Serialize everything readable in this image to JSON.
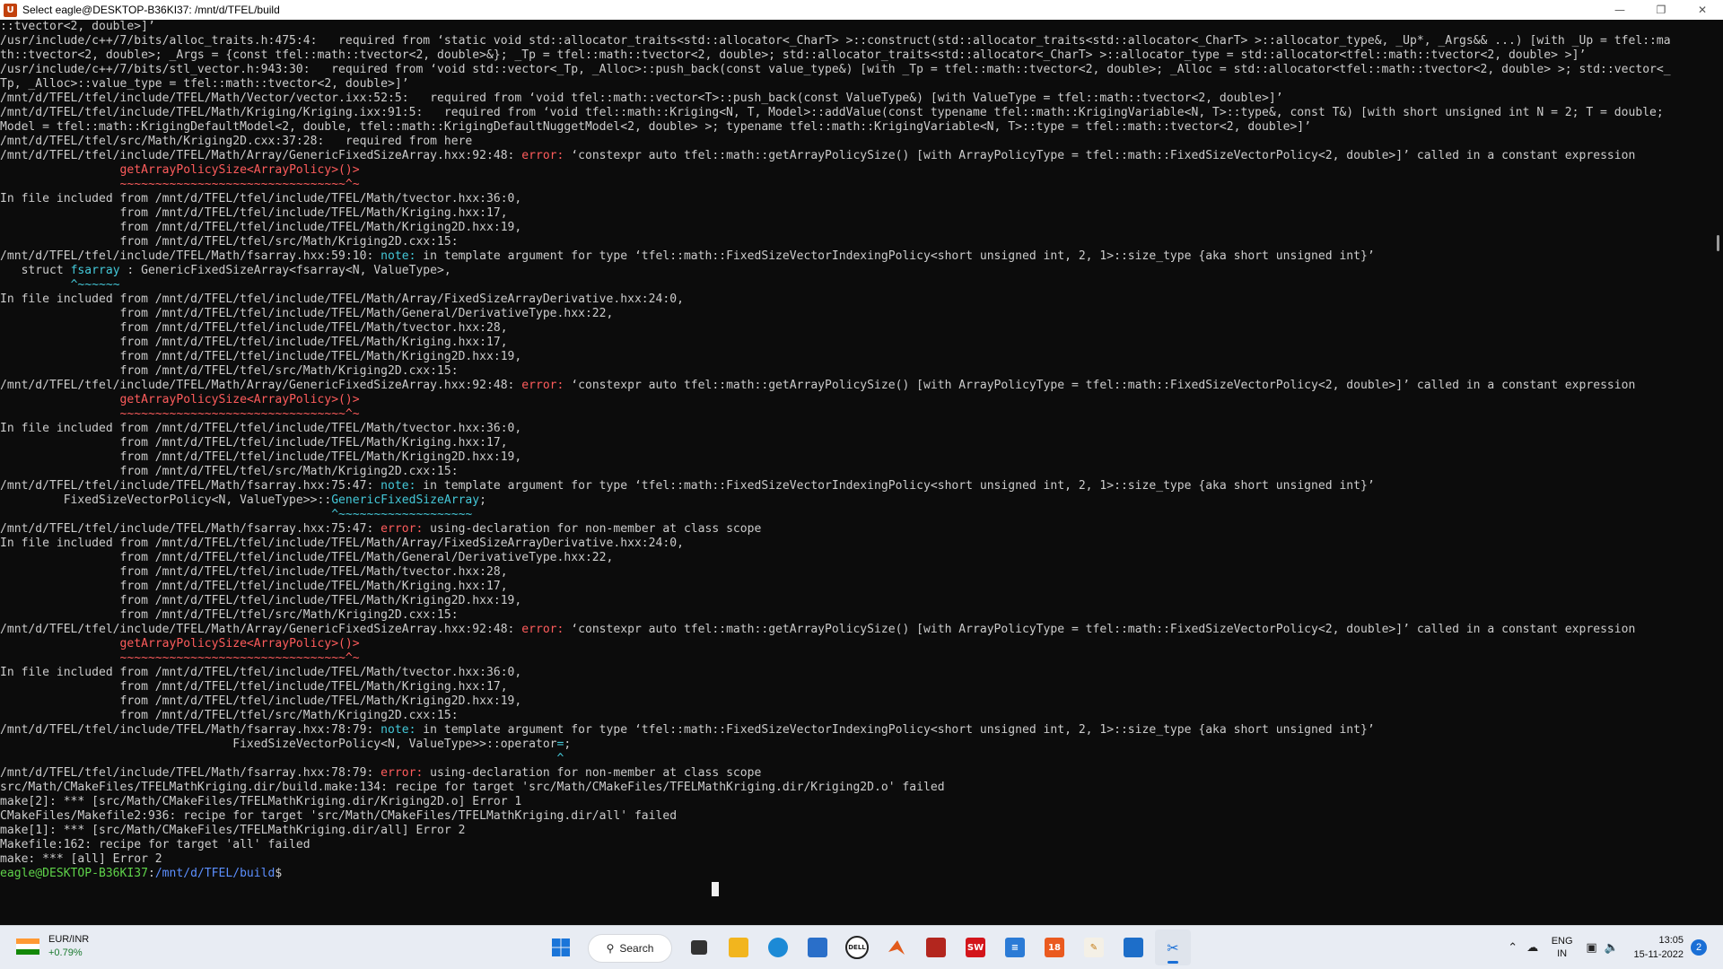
{
  "window": {
    "title": "Select eagle@DESKTOP-B36KI37: /mnt/d/TFEL/build",
    "icon": "ubuntu-terminal-icon",
    "controls": [
      "minimize",
      "restore",
      "close"
    ]
  },
  "terminal": {
    "lines": [
      [
        {
          "t": "::tvector<2, double>]’"
        }
      ],
      [
        {
          "t": "/usr/include/c++/7/bits/alloc_traits.h:475:4:   required from ‘static void std::allocator_traits<std::allocator<_CharT> >::construct(std::allocator_traits<std::allocator<_CharT> >::allocator_type&, _Up*, _Args&& ...) [with _Up = tfel::ma"
        }
      ],
      [
        {
          "t": "th::tvector<2, double>; _Args = {const tfel::math::tvector<2, double>&}; _Tp = tfel::math::tvector<2, double>; std::allocator_traits<std::allocator<_CharT> >::allocator_type = std::allocator<tfel::math::tvector<2, double> >]’"
        }
      ],
      [
        {
          "t": "/usr/include/c++/7/bits/stl_vector.h:943:30:   required from ‘void std::vector<_Tp, _Alloc>::push_back(const value_type&) [with _Tp = tfel::math::tvector<2, double>; _Alloc = std::allocator<tfel::math::tvector<2, double> >; std::vector<_"
        }
      ],
      [
        {
          "t": "Tp, _Alloc>::value_type = tfel::math::tvector<2, double>]’"
        }
      ],
      [
        {
          "t": "/mnt/d/TFEL/tfel/include/TFEL/Math/Vector/vector.ixx:52:5:   required from ‘void tfel::math::vector<T>::push_back(const ValueType&) [with ValueType = tfel::math::tvector<2, double>]’"
        }
      ],
      [
        {
          "t": "/mnt/d/TFEL/tfel/include/TFEL/Math/Kriging/Kriging.ixx:91:5:   required from ‘void tfel::math::Kriging<N, T, Model>::addValue(const typename tfel::math::KrigingVariable<N, T>::type&, const T&) [with short unsigned int N = 2; T = double;"
        }
      ],
      [
        {
          "t": "Model = tfel::math::KrigingDefaultModel<2, double, tfel::math::KrigingDefaultNuggetModel<2, double> >; typename tfel::math::KrigingVariable<N, T>::type = tfel::math::tvector<2, double>]’"
        }
      ],
      [
        {
          "t": "/mnt/d/TFEL/tfel/src/Math/Kriging2D.cxx:37:28:   required from here"
        }
      ],
      [
        {
          "t": "/mnt/d/TFEL/tfel/include/TFEL/Math/Array/GenericFixedSizeArray.hxx:92:48: "
        },
        {
          "t": "error:",
          "c": "err"
        },
        {
          "t": " ‘constexpr auto tfel::math::getArrayPolicySize() [with ArrayPolicyType = tfel::math::FixedSizeVectorPolicy<2, double>]’ called in a constant expression"
        }
      ],
      [
        {
          "t": "                 "
        },
        {
          "t": "getArrayPolicySize<ArrayPolicy>()>",
          "c": "red"
        }
      ],
      [
        {
          "t": "                 "
        },
        {
          "t": "~~~~~~~~~~~~~~~~~~~~~~~~~~~~~~~~^~",
          "c": "red"
        }
      ],
      [
        {
          "t": "In file included from /mnt/d/TFEL/tfel/include/TFEL/Math/tvector.hxx:36:0,"
        }
      ],
      [
        {
          "t": "                 from /mnt/d/TFEL/tfel/include/TFEL/Math/Kriging.hxx:17,"
        }
      ],
      [
        {
          "t": "                 from /mnt/d/TFEL/tfel/include/TFEL/Math/Kriging2D.hxx:19,"
        }
      ],
      [
        {
          "t": "                 from /mnt/d/TFEL/tfel/src/Math/Kriging2D.cxx:15:"
        }
      ],
      [
        {
          "t": "/mnt/d/TFEL/tfel/include/TFEL/Math/fsarray.hxx:59:10: "
        },
        {
          "t": "note:",
          "c": "note"
        },
        {
          "t": " in template argument for type ‘tfel::math::FixedSizeVectorIndexingPolicy<short unsigned int, 2, 1>::size_type {aka short unsigned int}’"
        }
      ],
      [
        {
          "t": "   struct "
        },
        {
          "t": "fsarray",
          "c": "cyan"
        },
        {
          "t": " : GenericFixedSizeArray<fsarray<N, ValueType>,"
        }
      ],
      [
        {
          "t": "          "
        },
        {
          "t": "^~~~~~~",
          "c": "cyan"
        }
      ],
      [
        {
          "t": "In file included from /mnt/d/TFEL/tfel/include/TFEL/Math/Array/FixedSizeArrayDerivative.hxx:24:0,"
        }
      ],
      [
        {
          "t": "                 from /mnt/d/TFEL/tfel/include/TFEL/Math/General/DerivativeType.hxx:22,"
        }
      ],
      [
        {
          "t": "                 from /mnt/d/TFEL/tfel/include/TFEL/Math/tvector.hxx:28,"
        }
      ],
      [
        {
          "t": "                 from /mnt/d/TFEL/tfel/include/TFEL/Math/Kriging.hxx:17,"
        }
      ],
      [
        {
          "t": "                 from /mnt/d/TFEL/tfel/include/TFEL/Math/Kriging2D.hxx:19,"
        }
      ],
      [
        {
          "t": "                 from /mnt/d/TFEL/tfel/src/Math/Kriging2D.cxx:15:"
        }
      ],
      [
        {
          "t": "/mnt/d/TFEL/tfel/include/TFEL/Math/Array/GenericFixedSizeArray.hxx:92:48: "
        },
        {
          "t": "error:",
          "c": "err"
        },
        {
          "t": " ‘constexpr auto tfel::math::getArrayPolicySize() [with ArrayPolicyType = tfel::math::FixedSizeVectorPolicy<2, double>]’ called in a constant expression"
        }
      ],
      [
        {
          "t": "                 "
        },
        {
          "t": "getArrayPolicySize<ArrayPolicy>()>",
          "c": "red"
        }
      ],
      [
        {
          "t": "                 "
        },
        {
          "t": "~~~~~~~~~~~~~~~~~~~~~~~~~~~~~~~~^~",
          "c": "red"
        }
      ],
      [
        {
          "t": "In file included from /mnt/d/TFEL/tfel/include/TFEL/Math/tvector.hxx:36:0,"
        }
      ],
      [
        {
          "t": "                 from /mnt/d/TFEL/tfel/include/TFEL/Math/Kriging.hxx:17,"
        }
      ],
      [
        {
          "t": "                 from /mnt/d/TFEL/tfel/include/TFEL/Math/Kriging2D.hxx:19,"
        }
      ],
      [
        {
          "t": "                 from /mnt/d/TFEL/tfel/src/Math/Kriging2D.cxx:15:"
        }
      ],
      [
        {
          "t": "/mnt/d/TFEL/tfel/include/TFEL/Math/fsarray.hxx:75:47: "
        },
        {
          "t": "note:",
          "c": "note"
        },
        {
          "t": " in template argument for type ‘tfel::math::FixedSizeVectorIndexingPolicy<short unsigned int, 2, 1>::size_type {aka short unsigned int}’"
        }
      ],
      [
        {
          "t": "         FixedSizeVectorPolicy<N, ValueType>>::"
        },
        {
          "t": "GenericFixedSizeArray",
          "c": "cyan"
        },
        {
          "t": ";"
        }
      ],
      [
        {
          "t": "                                               "
        },
        {
          "t": "^~~~~~~~~~~~~~~~~~~~",
          "c": "cyan"
        }
      ],
      [
        {
          "t": "/mnt/d/TFEL/tfel/include/TFEL/Math/fsarray.hxx:75:47: "
        },
        {
          "t": "error:",
          "c": "err"
        },
        {
          "t": " using-declaration for non-member at class scope"
        }
      ],
      [
        {
          "t": "In file included from /mnt/d/TFEL/tfel/include/TFEL/Math/Array/FixedSizeArrayDerivative.hxx:24:0,"
        }
      ],
      [
        {
          "t": "                 from /mnt/d/TFEL/tfel/include/TFEL/Math/General/DerivativeType.hxx:22,"
        }
      ],
      [
        {
          "t": "                 from /mnt/d/TFEL/tfel/include/TFEL/Math/tvector.hxx:28,"
        }
      ],
      [
        {
          "t": "                 from /mnt/d/TFEL/tfel/include/TFEL/Math/Kriging.hxx:17,"
        }
      ],
      [
        {
          "t": "                 from /mnt/d/TFEL/tfel/include/TFEL/Math/Kriging2D.hxx:19,"
        }
      ],
      [
        {
          "t": "                 from /mnt/d/TFEL/tfel/src/Math/Kriging2D.cxx:15:"
        }
      ],
      [
        {
          "t": "/mnt/d/TFEL/tfel/include/TFEL/Math/Array/GenericFixedSizeArray.hxx:92:48: "
        },
        {
          "t": "error:",
          "c": "err"
        },
        {
          "t": " ‘constexpr auto tfel::math::getArrayPolicySize() [with ArrayPolicyType = tfel::math::FixedSizeVectorPolicy<2, double>]’ called in a constant expression"
        }
      ],
      [
        {
          "t": "                 "
        },
        {
          "t": "getArrayPolicySize<ArrayPolicy>()>",
          "c": "red"
        }
      ],
      [
        {
          "t": "                 "
        },
        {
          "t": "~~~~~~~~~~~~~~~~~~~~~~~~~~~~~~~~^~",
          "c": "red"
        }
      ],
      [
        {
          "t": "In file included from /mnt/d/TFEL/tfel/include/TFEL/Math/tvector.hxx:36:0,"
        }
      ],
      [
        {
          "t": "                 from /mnt/d/TFEL/tfel/include/TFEL/Math/Kriging.hxx:17,"
        }
      ],
      [
        {
          "t": "                 from /mnt/d/TFEL/tfel/include/TFEL/Math/Kriging2D.hxx:19,"
        }
      ],
      [
        {
          "t": "                 from /mnt/d/TFEL/tfel/src/Math/Kriging2D.cxx:15:"
        }
      ],
      [
        {
          "t": "/mnt/d/TFEL/tfel/include/TFEL/Math/fsarray.hxx:78:79: "
        },
        {
          "t": "note:",
          "c": "note"
        },
        {
          "t": " in template argument for type ‘tfel::math::FixedSizeVectorIndexingPolicy<short unsigned int, 2, 1>::size_type {aka short unsigned int}’"
        }
      ],
      [
        {
          "t": "                                 FixedSizeVectorPolicy<N, ValueType>>::operator"
        },
        {
          "t": "=",
          "c": "cyan"
        },
        {
          "t": ";"
        }
      ],
      [
        {
          "t": "                                                                               "
        },
        {
          "t": "^",
          "c": "cyan"
        }
      ],
      [
        {
          "t": "/mnt/d/TFEL/tfel/include/TFEL/Math/fsarray.hxx:78:79: "
        },
        {
          "t": "error:",
          "c": "err"
        },
        {
          "t": " using-declaration for non-member at class scope"
        }
      ],
      [
        {
          "t": "src/Math/CMakeFiles/TFELMathKriging.dir/build.make:134: recipe for target 'src/Math/CMakeFiles/TFELMathKriging.dir/Kriging2D.o' failed"
        }
      ],
      [
        {
          "t": "make[2]: *** [src/Math/CMakeFiles/TFELMathKriging.dir/Kriging2D.o] Error 1"
        }
      ],
      [
        {
          "t": "CMakeFiles/Makefile2:936: recipe for target 'src/Math/CMakeFiles/TFELMathKriging.dir/all' failed"
        }
      ],
      [
        {
          "t": "make[1]: *** [src/Math/CMakeFiles/TFELMathKriging.dir/all] Error 2"
        }
      ],
      [
        {
          "t": "Makefile:162: recipe for target 'all' failed"
        }
      ],
      [
        {
          "t": "make: *** [all] Error 2"
        }
      ],
      [
        {
          "t": "eagle@DESKTOP-B36KI37",
          "c": "green"
        },
        {
          "t": ":"
        },
        {
          "t": "/mnt/d/TFEL/build",
          "c": "blue"
        },
        {
          "t": "$ "
        }
      ]
    ]
  },
  "taskbar": {
    "widget": {
      "name": "EUR/INR",
      "change": "+0.79%"
    },
    "search_label": "Search",
    "apps": [
      {
        "name": "start-button",
        "icon": "windows-icon"
      },
      {
        "name": "task-view-button",
        "icon": "task-view-icon"
      },
      {
        "name": "file-explorer-button",
        "icon": "folder-icon"
      },
      {
        "name": "edge-button",
        "icon": "edge-icon"
      },
      {
        "name": "store-button",
        "icon": "store-icon"
      },
      {
        "name": "dell-button",
        "icon": "dell-icon"
      },
      {
        "name": "matlab-button",
        "icon": "matlab-icon"
      },
      {
        "name": "abaqus-button",
        "icon": "cube-icon"
      },
      {
        "name": "solidworks-button",
        "icon": "solidworks-icon"
      },
      {
        "name": "notepad-button",
        "icon": "notepad-icon"
      },
      {
        "name": "app-button",
        "icon": "app-icon"
      },
      {
        "name": "paint-button",
        "icon": "paint-icon"
      },
      {
        "name": "window-button",
        "icon": "window-icon"
      },
      {
        "name": "snip-button",
        "icon": "snip-icon"
      }
    ],
    "tray": {
      "lang_line1": "ENG",
      "lang_line2": "IN",
      "time": "13:05",
      "date": "15-11-2022",
      "notifications": "2"
    }
  }
}
